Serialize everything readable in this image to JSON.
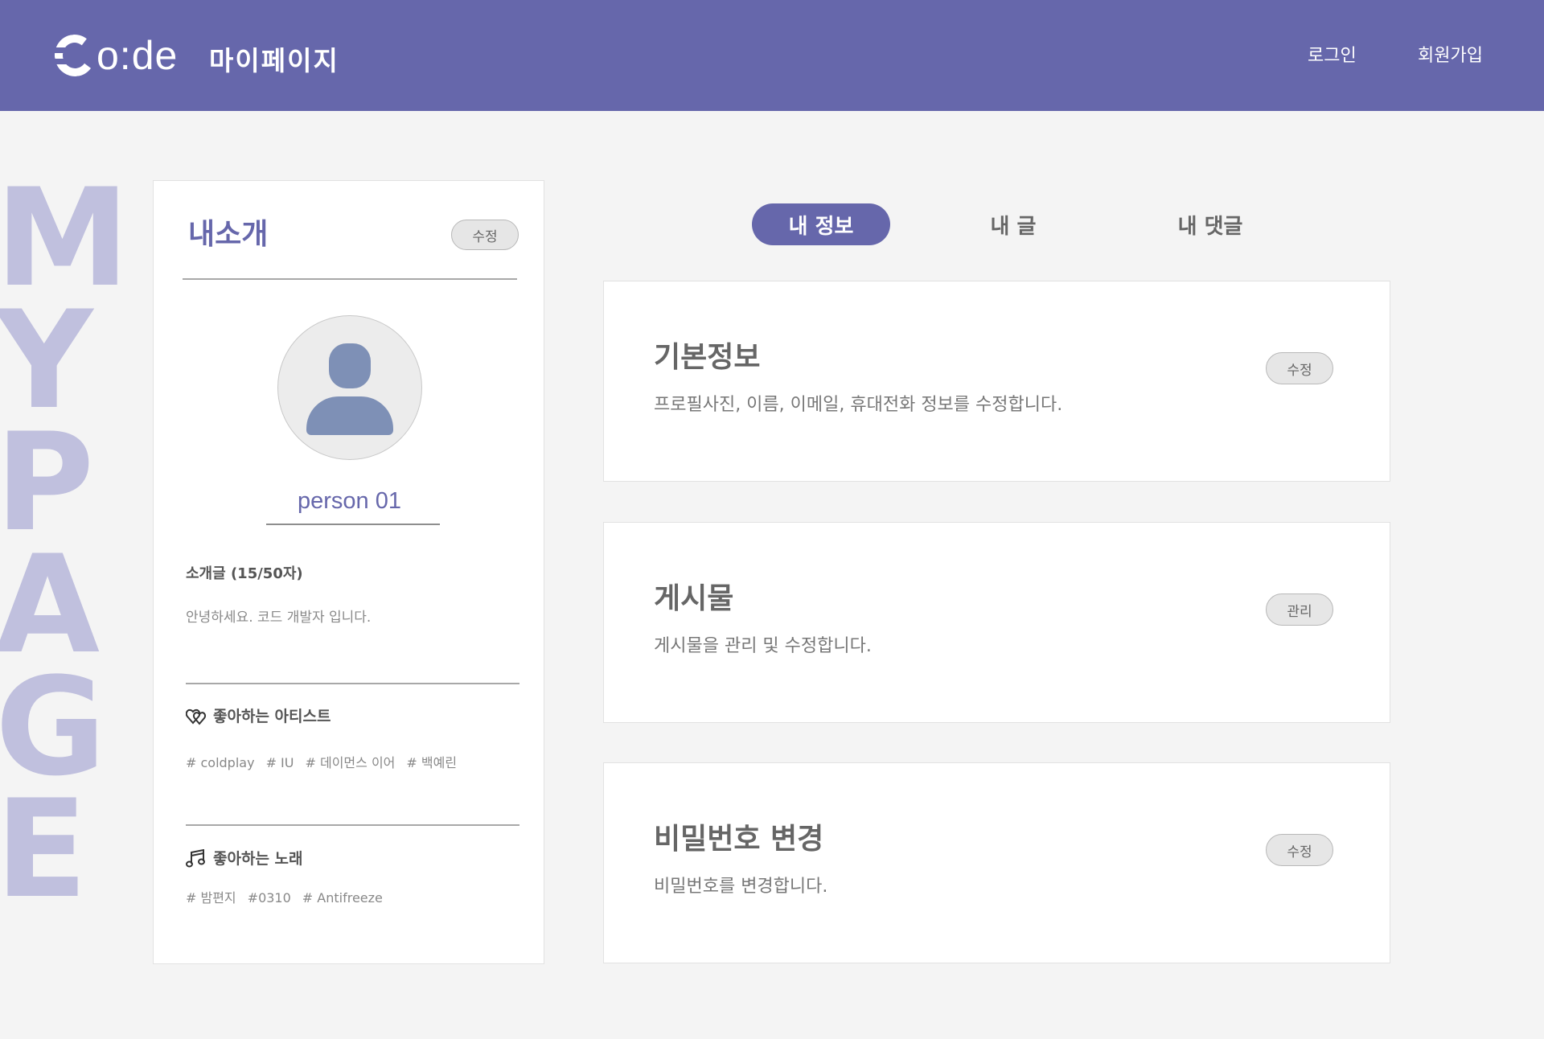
{
  "header": {
    "logo_text": "o:de",
    "logo_alt": "Co:de",
    "page_title": "마이페이지",
    "login": "로그인",
    "signup": "회원가입"
  },
  "side_letters": [
    "M",
    "Y",
    "P",
    "A",
    "G",
    "E"
  ],
  "profile": {
    "title": "내소개",
    "edit_label": "수정",
    "name": "person 01",
    "bio_label": "소개글 (15/50자)",
    "bio_text": "안녕하세요. 코드 개발자 입니다.",
    "artists_label": "좋아하는 아티스트",
    "artists": [
      "# coldplay",
      "# IU",
      "# 데이먼스 이어",
      "# 백예린"
    ],
    "songs_label": "좋아하는 노래",
    "songs": [
      "# 밤편지",
      "#0310",
      "# Antifreeze"
    ]
  },
  "tabs": [
    {
      "label": "내 정보",
      "active": true
    },
    {
      "label": "내 글",
      "active": false
    },
    {
      "label": "내 댓글",
      "active": false
    }
  ],
  "cards": [
    {
      "title": "기본정보",
      "desc": "프로필사진, 이름, 이메일, 휴대전화 정보를 수정합니다.",
      "button": "수정"
    },
    {
      "title": "게시물",
      "desc": "게시물을 관리 및 수정합니다.",
      "button": "관리"
    },
    {
      "title": "비밀번호 변경",
      "desc": "비밀번호를 변경합니다.",
      "button": "수정"
    }
  ],
  "colors": {
    "brand": "#6667ab",
    "side_letters": "#c0c0de",
    "avatar": "#7e90b6",
    "background": "#f4f4f4"
  },
  "icons": {
    "avatar": "user-silhouette-icon",
    "artists": "hearts-icon",
    "songs": "music-notes-icon"
  }
}
